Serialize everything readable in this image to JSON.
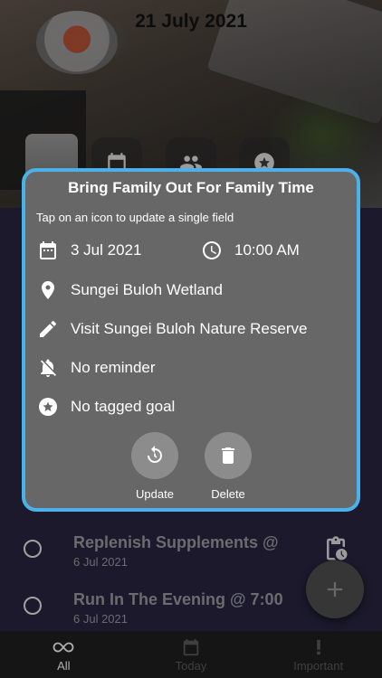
{
  "header": {
    "date_title": "21 July 2021",
    "filter_icons": [
      "calendar-icon",
      "group-icon",
      "star-icon"
    ]
  },
  "dialog": {
    "title": "Bring Family Out For Family Time",
    "hint": "Tap on an icon to update a single field",
    "date": "3 Jul 2021",
    "time": "10:00 AM",
    "location": "Sungei Buloh Wetland",
    "description": "Visit Sungei Buloh Nature Reserve",
    "reminder": "No reminder",
    "goal": "No tagged goal",
    "update_label": "Update",
    "delete_label": "Delete",
    "accent_color": "#4ab1ea"
  },
  "tasks": [
    {
      "title": "Replenish Supplements @",
      "date": "6 Jul 2021",
      "icon": "clipboard-clock-icon"
    },
    {
      "title": "Run In The Evening @ 7:00",
      "date": "6 Jul 2021",
      "icon": "clipboard-clock-icon"
    }
  ],
  "bottom_nav": [
    {
      "label": "All",
      "icon": "infinity-icon",
      "active": true
    },
    {
      "label": "Today",
      "icon": "calendar-icon",
      "active": false
    },
    {
      "label": "Important",
      "icon": "exclamation-icon",
      "active": false
    }
  ]
}
